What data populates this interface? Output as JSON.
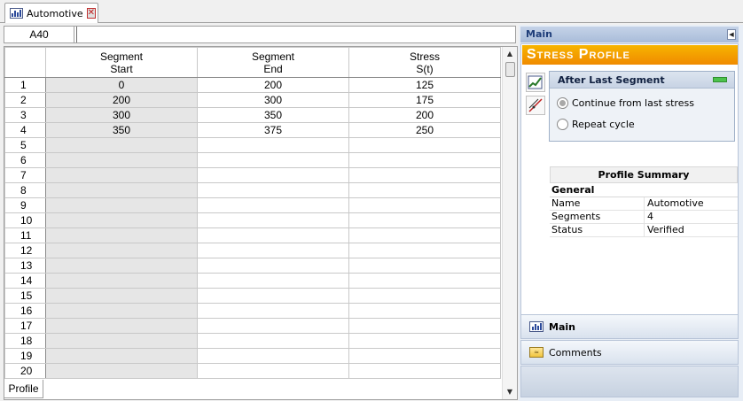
{
  "document_tab": {
    "title": "Automotive"
  },
  "formula_bar": {
    "cell_ref": "A40",
    "content": ""
  },
  "grid": {
    "columns": [
      {
        "line1": "Segment",
        "line2": "Start"
      },
      {
        "line1": "Segment",
        "line2": "End"
      },
      {
        "line1": "Stress",
        "line2": "S(t)"
      }
    ],
    "rows": [
      {
        "n": "1",
        "start": "0",
        "end": "200",
        "stress": "125"
      },
      {
        "n": "2",
        "start": "200",
        "end": "300",
        "stress": "175"
      },
      {
        "n": "3",
        "start": "300",
        "end": "350",
        "stress": "200"
      },
      {
        "n": "4",
        "start": "350",
        "end": "375",
        "stress": "250"
      },
      {
        "n": "5",
        "start": "",
        "end": "",
        "stress": ""
      },
      {
        "n": "6",
        "start": "",
        "end": "",
        "stress": ""
      },
      {
        "n": "7",
        "start": "",
        "end": "",
        "stress": ""
      },
      {
        "n": "8",
        "start": "",
        "end": "",
        "stress": ""
      },
      {
        "n": "9",
        "start": "",
        "end": "",
        "stress": ""
      },
      {
        "n": "10",
        "start": "",
        "end": "",
        "stress": ""
      },
      {
        "n": "11",
        "start": "",
        "end": "",
        "stress": ""
      },
      {
        "n": "12",
        "start": "",
        "end": "",
        "stress": ""
      },
      {
        "n": "13",
        "start": "",
        "end": "",
        "stress": ""
      },
      {
        "n": "14",
        "start": "",
        "end": "",
        "stress": ""
      },
      {
        "n": "15",
        "start": "",
        "end": "",
        "stress": ""
      },
      {
        "n": "16",
        "start": "",
        "end": "",
        "stress": ""
      },
      {
        "n": "17",
        "start": "",
        "end": "",
        "stress": ""
      },
      {
        "n": "18",
        "start": "",
        "end": "",
        "stress": ""
      },
      {
        "n": "19",
        "start": "",
        "end": "",
        "stress": ""
      },
      {
        "n": "20",
        "start": "",
        "end": "",
        "stress": ""
      }
    ]
  },
  "sheet_tab": {
    "label": "Profile"
  },
  "right_panel": {
    "header": "Main",
    "banner": "Stress Profile",
    "after_last_segment": {
      "title": "After Last Segment",
      "options": [
        {
          "label": "Continue from last stress",
          "checked": true
        },
        {
          "label": "Repeat cycle",
          "checked": false
        }
      ]
    },
    "summary": {
      "title": "Profile Summary",
      "section": "General",
      "rows": [
        {
          "key": "Name",
          "value": "Automotive"
        },
        {
          "key": "Segments",
          "value": "4"
        },
        {
          "key": "Status",
          "value": "Verified"
        }
      ]
    },
    "nav": {
      "main": "Main",
      "comments": "Comments"
    }
  },
  "colors": {
    "banner_start": "#f7b500",
    "banner_end": "#f08a00",
    "locked_cell": "#e6e6e6",
    "panel_header_text": "#1f3e7a"
  }
}
